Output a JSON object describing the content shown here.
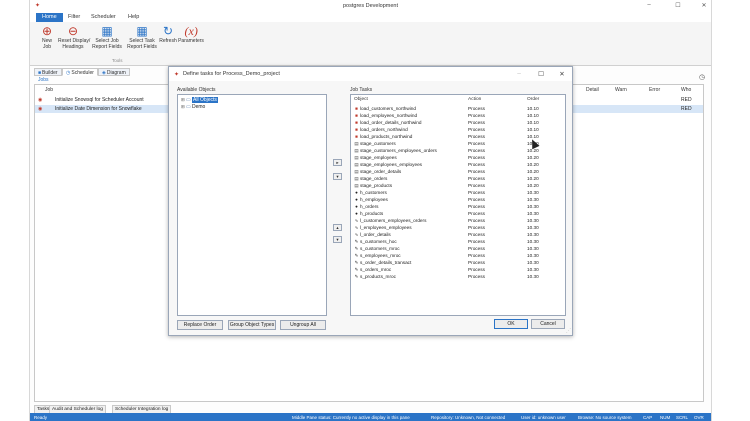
{
  "app": {
    "title": "postgres Development",
    "controls": {
      "minimize": "–",
      "maximize": "☐",
      "close": "✕"
    }
  },
  "menu": [
    "Home",
    "Filter",
    "Scheduler",
    "Help"
  ],
  "ribbon": {
    "buttons": [
      {
        "label": "New\nJob",
        "icon": "new-job-icon"
      },
      {
        "label": "Reset Display/\nHeadings",
        "icon": "reset-icon"
      },
      {
        "label": "Select Job\nReport Fields",
        "icon": "report-icon"
      },
      {
        "label": "Select Task\nReport Fields",
        "icon": "report-icon"
      },
      {
        "label": "Refresh",
        "icon": "refresh-icon"
      },
      {
        "label": "Parameters",
        "icon": "parameters-icon"
      }
    ],
    "group_label": "Tools"
  },
  "tabs": [
    "Builder",
    "Scheduler",
    "Diagram"
  ],
  "jobs_label": "Jobs",
  "job_grid": {
    "headers": [
      "Job",
      "Detail",
      "Warn",
      "Error",
      "Who"
    ],
    "rows": [
      {
        "name": "Initialize Snowsql for Scheduler Account",
        "who": "RED"
      },
      {
        "name": "Initialize Date Dimension for Snowflake",
        "who": "RED"
      }
    ]
  },
  "bottom_tabs": [
    "Tasks",
    "Audit and Scheduler log",
    "Scheduler Integration log"
  ],
  "status": {
    "ready": "Ready",
    "middle": "Middle Pane status: Currently no active display in this pane",
    "repo": "Repository: Unknown, Not connected",
    "user": "User id: unknown user",
    "browse": "Browse: No source system",
    "flags": [
      "CAP",
      "NUM",
      "SCRL",
      "OVR"
    ]
  },
  "dialog": {
    "title": "Define tasks for Process_Demo_project",
    "available_label": "Available Objects",
    "tree": [
      {
        "label": "All Objects",
        "selected": true
      },
      {
        "label": "Demo",
        "selected": false
      }
    ],
    "job_tasks_label": "Job Tasks",
    "columns": [
      "Object",
      "Action",
      "Order"
    ],
    "tasks": [
      {
        "object": "load_customers_northwind",
        "action": "Process",
        "order": "10.10",
        "icon": "load"
      },
      {
        "object": "load_employees_northwind",
        "action": "Process",
        "order": "10.10",
        "icon": "load"
      },
      {
        "object": "load_order_details_northwind",
        "action": "Process",
        "order": "10.10",
        "icon": "load"
      },
      {
        "object": "load_orders_northwind",
        "action": "Process",
        "order": "10.10",
        "icon": "load"
      },
      {
        "object": "load_products_northwind",
        "action": "Process",
        "order": "10.10",
        "icon": "load"
      },
      {
        "object": "stage_customers",
        "action": "Process",
        "order": "10.20",
        "icon": "stage"
      },
      {
        "object": "stage_customers_employees_orders",
        "action": "Process",
        "order": "10.20",
        "icon": "stage"
      },
      {
        "object": "stage_employees",
        "action": "Process",
        "order": "10.20",
        "icon": "stage"
      },
      {
        "object": "stage_employees_employees",
        "action": "Process",
        "order": "10.20",
        "icon": "stage"
      },
      {
        "object": "stage_order_details",
        "action": "Process",
        "order": "10.20",
        "icon": "stage"
      },
      {
        "object": "stage_orders",
        "action": "Process",
        "order": "10.20",
        "icon": "stage"
      },
      {
        "object": "stage_products",
        "action": "Process",
        "order": "10.20",
        "icon": "stage"
      },
      {
        "object": "h_customers",
        "action": "Process",
        "order": "10.30",
        "icon": "hub"
      },
      {
        "object": "h_employees",
        "action": "Process",
        "order": "10.30",
        "icon": "hub"
      },
      {
        "object": "h_orders",
        "action": "Process",
        "order": "10.30",
        "icon": "hub"
      },
      {
        "object": "h_products",
        "action": "Process",
        "order": "10.30",
        "icon": "hub"
      },
      {
        "object": "l_customers_employees_orders",
        "action": "Process",
        "order": "10.30",
        "icon": "link"
      },
      {
        "object": "l_employees_employees",
        "action": "Process",
        "order": "10.30",
        "icon": "link"
      },
      {
        "object": "l_order_details",
        "action": "Process",
        "order": "10.30",
        "icon": "link"
      },
      {
        "object": "s_customers_hoc",
        "action": "Process",
        "order": "10.30",
        "icon": "sat"
      },
      {
        "object": "s_customers_mroc",
        "action": "Process",
        "order": "10.30",
        "icon": "sat"
      },
      {
        "object": "s_employees_mroc",
        "action": "Process",
        "order": "10.30",
        "icon": "sat"
      },
      {
        "object": "s_order_details_transact",
        "action": "Process",
        "order": "10.30",
        "icon": "sat"
      },
      {
        "object": "s_orders_mroc",
        "action": "Process",
        "order": "10.30",
        "icon": "sat"
      },
      {
        "object": "s_products_mroc",
        "action": "Process",
        "order": "10.30",
        "icon": "sat"
      }
    ],
    "buttons": {
      "replace_order": "Replace Order",
      "group_object_types": "Group Object Types",
      "ungroup_all": "Ungroup All",
      "ok": "OK",
      "cancel": "Cancel"
    }
  }
}
